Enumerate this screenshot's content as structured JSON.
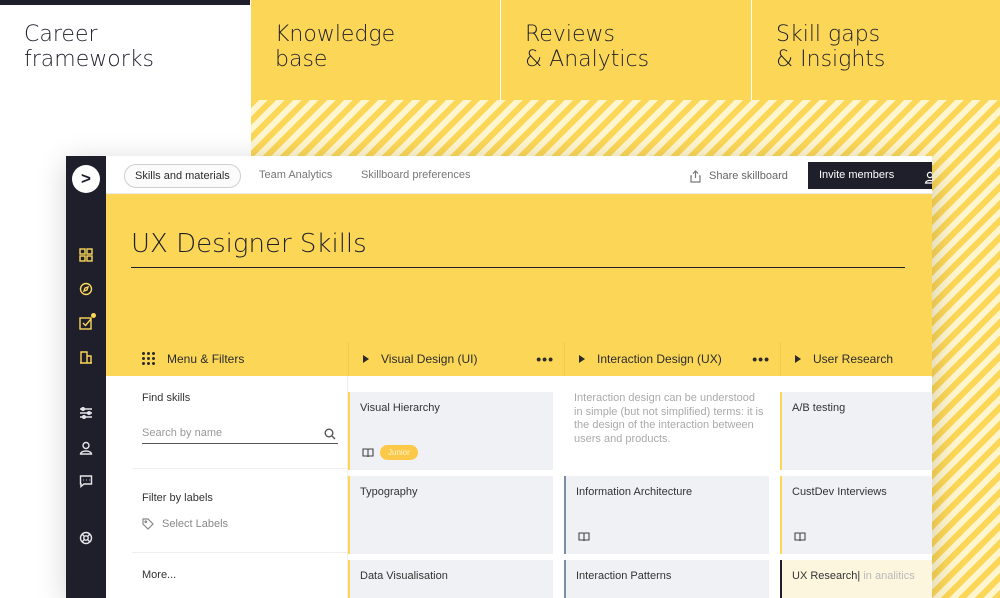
{
  "marketing_tabs": [
    {
      "label": "Career\nframeworks"
    },
    {
      "label": "Knowledge\nbase"
    },
    {
      "label": "Reviews\n& Analytics"
    },
    {
      "label": "Skill gaps\n& Insights"
    }
  ],
  "rail": {
    "logo": ">",
    "icons": [
      "grid-icon",
      "compass-icon",
      "checkbox-icon",
      "buildings-icon",
      "sliders-icon",
      "user-icon",
      "chat-icon",
      "help-icon"
    ]
  },
  "topnav": {
    "tabs": [
      "Skills and materials",
      "Team Analytics",
      "Skillboard preferences"
    ],
    "share_label": "Share skillboard",
    "invite_label": "Invite members"
  },
  "hero": {
    "title": "UX Designer Skills"
  },
  "columns": {
    "menu_label": "Menu & Filters",
    "headers": [
      "Visual Design (UI)",
      "Interaction Design (UX)",
      "User Research"
    ],
    "dots": "•••"
  },
  "filters": {
    "find_label": "Find skills",
    "search_placeholder": "Search by name",
    "labels_title": "Filter by labels",
    "select_labels": "Select Labels",
    "more_label": "More..."
  },
  "cards": {
    "visual": [
      "Visual Hierarchy",
      "Typography",
      "Data Visualisation"
    ],
    "visual_badge": "Junior",
    "interaction_desc": "Interaction design can be understood in simple (but not simplified) terms: it is the design of the interaction between users and products.",
    "interaction": [
      "Information Architecture",
      "Interaction Patterns"
    ],
    "research": [
      "A/B testing",
      "CustDev Interviews"
    ],
    "research_input": "UX Research",
    "research_input_hint": "in analitics"
  },
  "colors": {
    "accent": "#fcd757",
    "dark": "#1f1f2b",
    "card": "#eff1f4"
  }
}
